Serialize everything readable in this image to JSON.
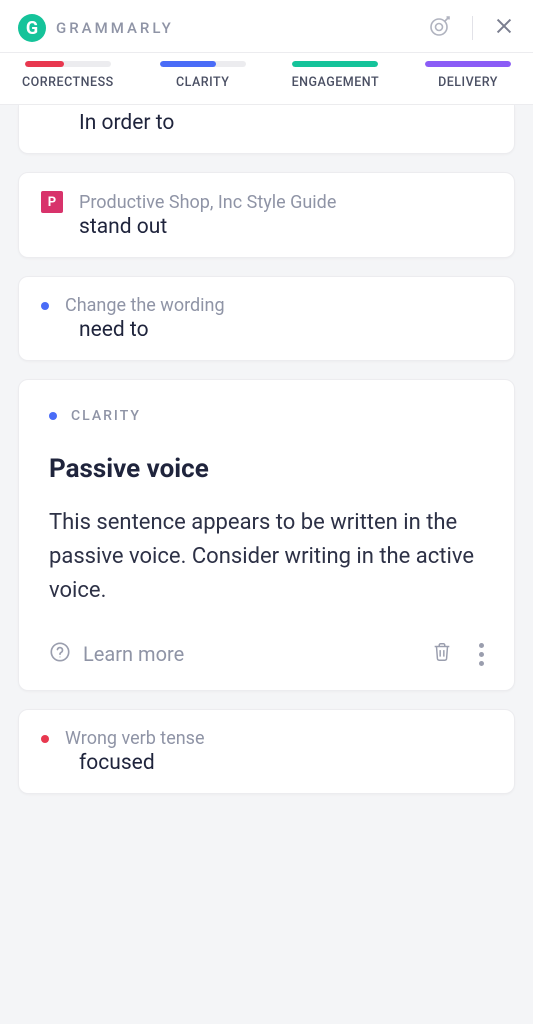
{
  "brand": {
    "logoLetter": "G",
    "name": "GRAMMARLY"
  },
  "colors": {
    "correctness": "#e8384f",
    "clarity": "#4a6cf7",
    "engagement": "#15c39a",
    "delivery": "#8b5cf6",
    "pbadge": "#d8336b"
  },
  "tabs": [
    {
      "id": "correctness",
      "label": "CORRECTNESS",
      "fill": 0.45
    },
    {
      "id": "clarity",
      "label": "CLARITY",
      "fill": 0.65
    },
    {
      "id": "engagement",
      "label": "ENGAGEMENT",
      "fill": 1.0
    },
    {
      "id": "delivery",
      "label": "DELIVERY",
      "fill": 1.0
    }
  ],
  "cards": {
    "c1": {
      "text": "In order to"
    },
    "c2": {
      "badge": "P",
      "hint": "Productive Shop, Inc Style Guide",
      "text": "stand out"
    },
    "c3": {
      "dotColorKey": "clarity",
      "hint": "Change the wording",
      "text": "need to"
    },
    "c4": {
      "dotColorKey": "correctness",
      "hint": "Wrong verb tense",
      "text": "focused"
    }
  },
  "expanded": {
    "tagDotKey": "clarity",
    "tagLabel": "CLARITY",
    "title": "Passive voice",
    "body": "This sentence appears to be written in the passive voice. Consider writing in the active voice.",
    "learnMore": "Learn more"
  }
}
